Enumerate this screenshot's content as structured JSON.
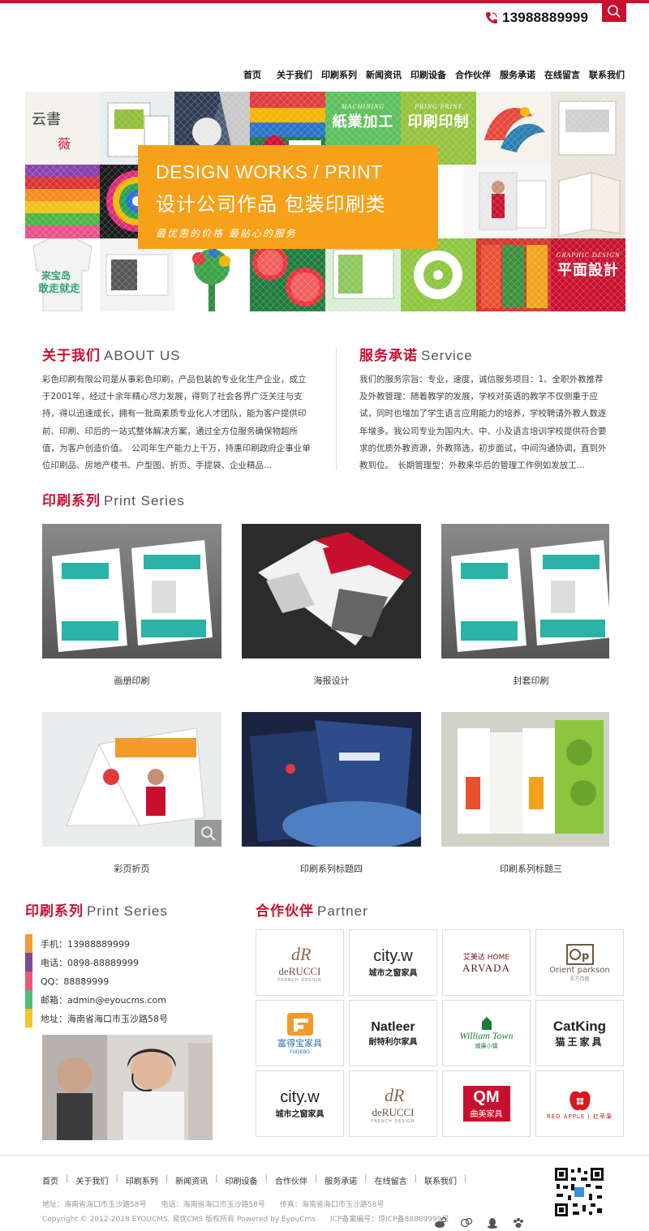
{
  "header": {
    "phone": "13988889999",
    "nav": [
      "首页",
      "关于我们",
      "印刷系列",
      "新闻资讯",
      "印刷设备",
      "合作伙伴",
      "服务承诺",
      "在线留言",
      "联系我们"
    ]
  },
  "banner": {
    "title_en": "DESIGN WORKS / PRINT",
    "title_cn": "设计公司作品 包装印刷类",
    "subtitle": "最优惠的价格 最贴心的服务",
    "tile_machining_small": "MACHINING",
    "tile_machining_big": "紙業加工",
    "tile_print_small": "PRING PRINT",
    "tile_print_big": "印刷印制",
    "tile_graphic_small": "GRAPHIC DESIGN",
    "tile_graphic_big": "平面設計"
  },
  "about": {
    "title_cn": "关于我们",
    "title_en": "ABOUT US",
    "text": "彩色印刷有限公司是从事彩色印刷，产品包装的专业化生产企业，成立于2001年，经过十余年精心尽力发展，得到了社会各界广泛关注与支持，得以迅速成长，拥有一批高素质专业化人才团队，能为客户提供印前、印刷、印后的一站式整体解决方案，通过全方位服务确保物超所值，为客户创造价值。　公司年生产能力上千万，持惠印刷政府企事业单位印刷品、房地产楼书、户型图、折页、手提袋、企业精品..."
  },
  "service": {
    "title_cn": "服务承诺",
    "title_en": "Service",
    "text": "我们的服务宗旨：专业，速度，诚信服务项目：1、全职外教推荐及外教管理：随着教学的发展，学校对英语的教学不仅侧重于应试，同时也增加了学生语言应用能力的培养，学校聘请外教人数逐年增多。我公司专业为国内大、中、小及语言培训学校提供符合要求的优质外教资源，外教筛选，初步面试，中间沟通协调，直到外教到位。　长期管理型：外教来华后的管理工作例如发放工..."
  },
  "print_series": {
    "title_cn": "印刷系列",
    "title_en": "Print Series",
    "items": [
      {
        "caption": "画册印刷"
      },
      {
        "caption": "海报设计"
      },
      {
        "caption": "封套印刷"
      },
      {
        "caption": "彩页折页"
      },
      {
        "caption": "印刷系列标题四"
      },
      {
        "caption": "印刷系列标题三"
      }
    ]
  },
  "contact": {
    "title_cn": "印刷系列",
    "title_en": "Print Series",
    "items": [
      {
        "text": "手机：13988889999",
        "color": "#f39a3b"
      },
      {
        "text": "电话：0898-88889999",
        "color": "#7c4a8e"
      },
      {
        "text": "QQ：88889999",
        "color": "#e8567a"
      },
      {
        "text": "邮箱：admin@eyoucms.com",
        "color": "#4bbf73"
      },
      {
        "text": "地址：海南省海口市玉沙路58号",
        "color": "#f5c42c"
      }
    ]
  },
  "partner": {
    "title_cn": "合作伙伴",
    "title_en": "Partner",
    "logos": [
      {
        "line1": "deRUCCI",
        "line2": "FRENCH DESIGN",
        "icon": "derucci-logo"
      },
      {
        "line1": "city.w",
        "line2": "城市之窗家具",
        "icon": "cityw-logo"
      },
      {
        "line1": "艾美达 HOME",
        "line2": "ARVADA",
        "icon": "arvada-logo"
      },
      {
        "line1": "Orient parkson",
        "line2": "东方百盛",
        "icon": "orient-parkson-logo"
      },
      {
        "line1": "富得宝家具",
        "line2": "FUDEBO",
        "icon": "fudebo-logo"
      },
      {
        "line1": "Natleer",
        "line2": "耐特利尔家具",
        "icon": "natleer-logo"
      },
      {
        "line1": "William Town",
        "line2": "威廉小镇",
        "icon": "william-town-logo"
      },
      {
        "line1": "CatKing",
        "line2": "猫王家具",
        "icon": "catking-logo"
      },
      {
        "line1": "city.w",
        "line2": "城市之窗家具",
        "icon": "cityw-logo"
      },
      {
        "line1": "deRUCCI",
        "line2": "FRENCH DESIGN",
        "icon": "derucci-logo"
      },
      {
        "line1": "QM",
        "line2": "曲美家具",
        "icon": "qumei-logo"
      },
      {
        "line1": "RED APPLE",
        "line2": "红苹果",
        "icon": "red-apple-logo"
      }
    ]
  },
  "footer": {
    "nav": [
      "首页",
      "关于我们",
      "印刷系列",
      "新闻资讯",
      "印刷设备",
      "合作伙伴",
      "服务承诺",
      "在线留言",
      "联系我们"
    ],
    "address_line": "地址：海南省海口市玉沙路58号　　电话：海南省海口市玉沙路58号　　传真：海南省海口市玉沙路58号",
    "copyright": "Copyright © 2012-2018 EYOUCMS. 易优CMS 版权所有 Powered by EyouCms　　ICP备案编号：琼ICP备88889999号"
  },
  "colors": {
    "brand": "#c8102e",
    "accent": "#f7a11a"
  }
}
